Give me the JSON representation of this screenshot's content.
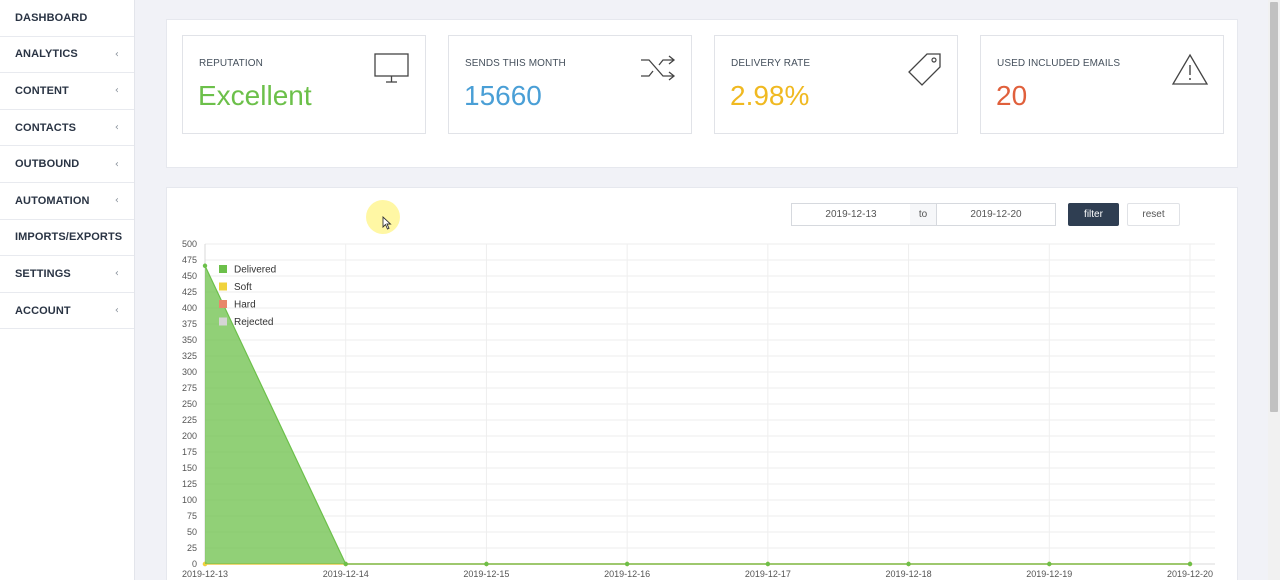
{
  "sidebar": {
    "items": [
      {
        "label": "DASHBOARD",
        "chevron": false
      },
      {
        "label": "ANALYTICS",
        "chevron": true
      },
      {
        "label": "CONTENT",
        "chevron": true
      },
      {
        "label": "CONTACTS",
        "chevron": true
      },
      {
        "label": "OUTBOUND",
        "chevron": true
      },
      {
        "label": "AUTOMATION",
        "chevron": true
      },
      {
        "label": "IMPORTS/EXPORTS",
        "chevron": false
      },
      {
        "label": "SETTINGS",
        "chevron": true
      },
      {
        "label": "ACCOUNT",
        "chevron": true
      }
    ],
    "chevron_glyph": "‹"
  },
  "stats": [
    {
      "title": "REPUTATION",
      "value": "Excellent",
      "color": "#6cc04a",
      "icon": "monitor-icon"
    },
    {
      "title": "SENDS THIS MONTH",
      "value": "15660",
      "color": "#4a9fd6",
      "icon": "shuffle-icon"
    },
    {
      "title": "DELIVERY RATE",
      "value": "2.98%",
      "color": "#f0b921",
      "icon": "tag-icon"
    },
    {
      "title": "USED INCLUDED EMAILS",
      "value": "20",
      "color": "#e0603c",
      "icon": "warning-icon"
    }
  ],
  "filter": {
    "from": "2019-12-13",
    "to_label": "to",
    "to": "2019-12-20",
    "filter_label": "filter",
    "reset_label": "reset"
  },
  "chart_data": {
    "type": "area",
    "x": [
      "2019-12-13",
      "2019-12-14",
      "2019-12-15",
      "2019-12-16",
      "2019-12-17",
      "2019-12-18",
      "2019-12-19",
      "2019-12-20"
    ],
    "ylim": [
      0,
      500
    ],
    "yticks": [
      0,
      25,
      50,
      75,
      100,
      125,
      150,
      175,
      200,
      225,
      250,
      275,
      300,
      325,
      350,
      375,
      400,
      425,
      450,
      475,
      500
    ],
    "grid": true,
    "legend_position": "top-left",
    "series": [
      {
        "name": "Delivered",
        "color": "#6cc04a",
        "values": [
          466,
          0,
          0,
          0,
          0,
          0,
          0,
          0
        ]
      },
      {
        "name": "Soft",
        "color": "#f0d33c",
        "values": [
          0,
          0,
          0,
          0,
          0,
          0,
          0,
          0
        ]
      },
      {
        "name": "Hard",
        "color": "#e8876a",
        "values": [
          0,
          0,
          0,
          0,
          0,
          0,
          0,
          0
        ]
      },
      {
        "name": "Rejected",
        "color": "#d5d5d5",
        "values": [
          0,
          0,
          0,
          0,
          0,
          0,
          0,
          0
        ]
      }
    ]
  }
}
